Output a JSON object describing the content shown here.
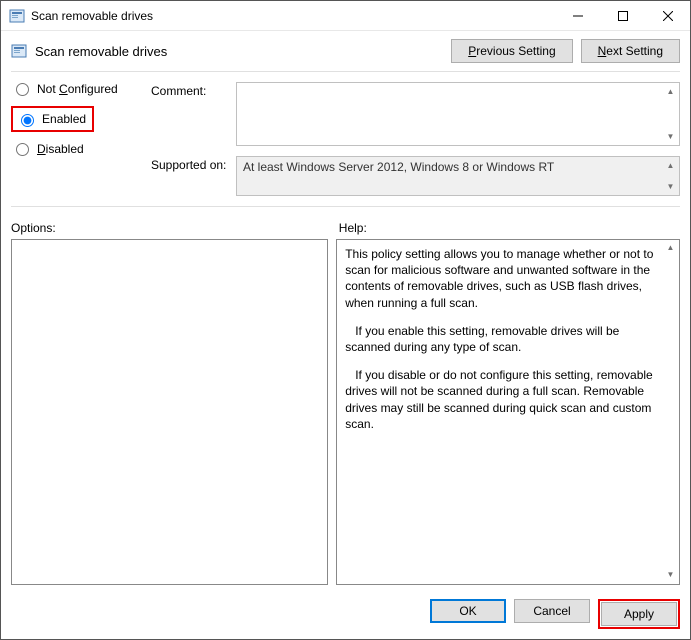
{
  "window": {
    "title": "Scan removable drives",
    "policy_name": "Scan removable drives"
  },
  "nav": {
    "previous": "Previous Setting",
    "next": "Next Setting"
  },
  "radio": {
    "not_configured": "Not Configured",
    "enabled": "Enabled",
    "disabled": "Disabled",
    "selected": "enabled"
  },
  "fields": {
    "comment_label": "Comment:",
    "comment_value": "",
    "supported_label": "Supported on:",
    "supported_value": "At least Windows Server 2012, Windows 8 or Windows RT"
  },
  "lower": {
    "options_label": "Options:",
    "help_label": "Help:",
    "options_content": "",
    "help_p1": "This policy setting allows you to manage whether or not to scan for malicious software and unwanted software in the contents of removable drives, such as USB flash drives, when running a full scan.",
    "help_p2": "If you enable this setting, removable drives will be scanned during any type of scan.",
    "help_p3": "If you disable or do not configure this setting, removable drives will not be scanned during a full scan. Removable drives may still be scanned during quick scan and custom scan."
  },
  "buttons": {
    "ok": "OK",
    "cancel": "Cancel",
    "apply": "Apply"
  }
}
